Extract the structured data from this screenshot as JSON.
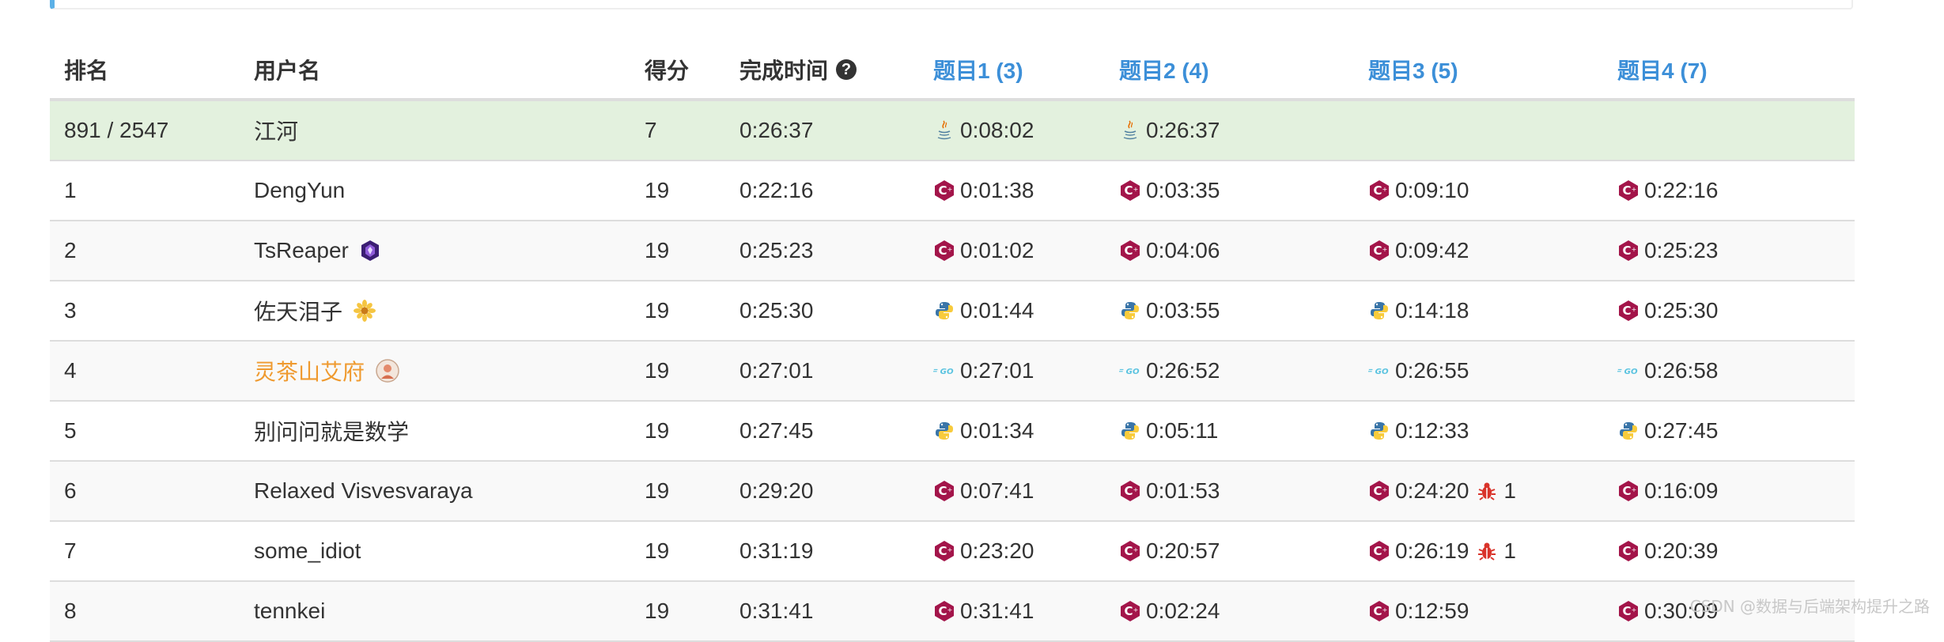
{
  "header": {
    "rank": "排名",
    "username": "用户名",
    "score": "得分",
    "finish_time": "完成时间",
    "q1": "题目1 (3)",
    "q2": "题目2 (4)",
    "q3": "题目3 (5)",
    "q4": "题目4 (7)"
  },
  "self_row": {
    "rank": "891 / 2547",
    "username": "江河",
    "score": "7",
    "finish_time": "0:26:37",
    "q1": {
      "lang": "java",
      "time": "0:08:02"
    },
    "q2": {
      "lang": "java",
      "time": "0:26:37"
    }
  },
  "rows": [
    {
      "rank": "1",
      "username": "DengYun",
      "score": "19",
      "finish_time": "0:22:16",
      "q1": {
        "lang": "cpp",
        "time": "0:01:38"
      },
      "q2": {
        "lang": "cpp",
        "time": "0:03:35"
      },
      "q3": {
        "lang": "cpp",
        "time": "0:09:10"
      },
      "q4": {
        "lang": "cpp",
        "time": "0:22:16"
      }
    },
    {
      "rank": "2",
      "username": "TsReaper",
      "badge": "guardian-badge",
      "score": "19",
      "finish_time": "0:25:23",
      "q1": {
        "lang": "cpp",
        "time": "0:01:02"
      },
      "q2": {
        "lang": "cpp",
        "time": "0:04:06"
      },
      "q3": {
        "lang": "cpp",
        "time": "0:09:42"
      },
      "q4": {
        "lang": "cpp",
        "time": "0:25:23"
      }
    },
    {
      "rank": "3",
      "username": "佐天泪子",
      "badge": "flower-badge",
      "score": "19",
      "finish_time": "0:25:30",
      "q1": {
        "lang": "python",
        "time": "0:01:44"
      },
      "q2": {
        "lang": "python",
        "time": "0:03:55"
      },
      "q3": {
        "lang": "python",
        "time": "0:14:18"
      },
      "q4": {
        "lang": "cpp",
        "time": "0:25:30"
      }
    },
    {
      "rank": "4",
      "username": "灵茶山艾府",
      "badge": "avatar-badge",
      "highlight": "#ef9a2f",
      "score": "19",
      "finish_time": "0:27:01",
      "q1": {
        "lang": "go",
        "time": "0:27:01"
      },
      "q2": {
        "lang": "go",
        "time": "0:26:52"
      },
      "q3": {
        "lang": "go",
        "time": "0:26:55"
      },
      "q4": {
        "lang": "go",
        "time": "0:26:58"
      }
    },
    {
      "rank": "5",
      "username": "别问问就是数学",
      "score": "19",
      "finish_time": "0:27:45",
      "q1": {
        "lang": "python",
        "time": "0:01:34"
      },
      "q2": {
        "lang": "python",
        "time": "0:05:11"
      },
      "q3": {
        "lang": "python",
        "time": "0:12:33"
      },
      "q4": {
        "lang": "python",
        "time": "0:27:45"
      }
    },
    {
      "rank": "6",
      "username": "Relaxed Visvesvaraya",
      "score": "19",
      "finish_time": "0:29:20",
      "q1": {
        "lang": "cpp",
        "time": "0:07:41"
      },
      "q2": {
        "lang": "cpp",
        "time": "0:01:53"
      },
      "q3": {
        "lang": "cpp",
        "time": "0:24:20",
        "bugs": "1"
      },
      "q4": {
        "lang": "cpp",
        "time": "0:16:09"
      }
    },
    {
      "rank": "7",
      "username": "some_idiot",
      "score": "19",
      "finish_time": "0:31:19",
      "q1": {
        "lang": "cpp",
        "time": "0:23:20"
      },
      "q2": {
        "lang": "cpp",
        "time": "0:20:57"
      },
      "q3": {
        "lang": "cpp",
        "time": "0:26:19",
        "bugs": "1"
      },
      "q4": {
        "lang": "cpp",
        "time": "0:20:39"
      }
    },
    {
      "rank": "8",
      "username": "tennkei",
      "score": "19",
      "finish_time": "0:31:41",
      "q1": {
        "lang": "cpp",
        "time": "0:31:41"
      },
      "q2": {
        "lang": "cpp",
        "time": "0:02:24"
      },
      "q3": {
        "lang": "cpp",
        "time": "0:12:59"
      },
      "q4": {
        "lang": "cpp",
        "time": "0:30:09"
      }
    }
  ],
  "watermark": "CSDN @数据与后端架构提升之路",
  "colors": {
    "question_header": "#3c8fd8",
    "self_row_bg": "#e3f1de",
    "highlight_user": "#ef9a2f",
    "cpp": "#a3154a",
    "go": "#5ac3e0",
    "java_cup": "#e76f00",
    "python_blue": "#3a75a8",
    "python_yellow": "#f8cb3c",
    "bug": "#d9342b"
  }
}
